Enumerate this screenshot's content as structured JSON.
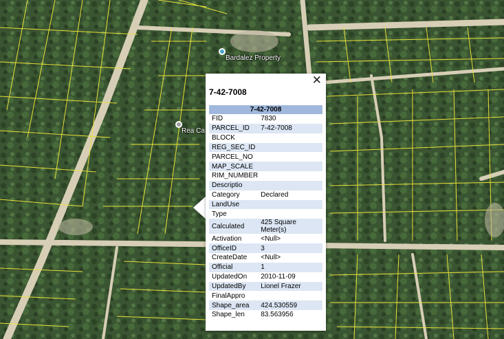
{
  "map": {
    "places": [
      {
        "label": "Bardalez Property"
      },
      {
        "label": "Rea Ca"
      }
    ]
  },
  "popup": {
    "title": "7-42-7008",
    "close_glyph": "✕",
    "table_header": "7-42-7008",
    "rows": [
      {
        "key": "FID",
        "value": "7830"
      },
      {
        "key": "PARCEL_ID",
        "value": "7-42-7008"
      },
      {
        "key": "BLOCK",
        "value": ""
      },
      {
        "key": "REG_SEC_ID",
        "value": ""
      },
      {
        "key": "PARCEL_NO",
        "value": ""
      },
      {
        "key": "MAP_SCALE",
        "value": ""
      },
      {
        "key": "RIM_NUMBER",
        "value": ""
      },
      {
        "key": "Descriptio",
        "value": ""
      },
      {
        "key": "Category",
        "value": "Declared"
      },
      {
        "key": "LandUse",
        "value": ""
      },
      {
        "key": "Type",
        "value": ""
      },
      {
        "key": "Calculated",
        "value": "425 Square Meter(s)"
      },
      {
        "key": "Activation",
        "value": "<Null>"
      },
      {
        "key": "OfficeID",
        "value": "3"
      },
      {
        "key": "CreateDate",
        "value": "<Null>"
      },
      {
        "key": "Official",
        "value": "1"
      },
      {
        "key": "UpdatedOn",
        "value": "2010-11-09"
      },
      {
        "key": "UpdatedBy",
        "value": "Lionel Frazer"
      },
      {
        "key": "FinalAppro",
        "value": ""
      },
      {
        "key": "Shape_area",
        "value": "424.530559"
      },
      {
        "key": "Shape_len",
        "value": "83.563956"
      }
    ]
  },
  "colors": {
    "parcel_line": "#e8e23a",
    "road": "#d8cfb8",
    "vegetation_dark": "#2f4a2a",
    "header_fill": "#a0b8dc",
    "row_alt_fill": "#dce6f4",
    "place_pin": "#4aa3c9"
  }
}
